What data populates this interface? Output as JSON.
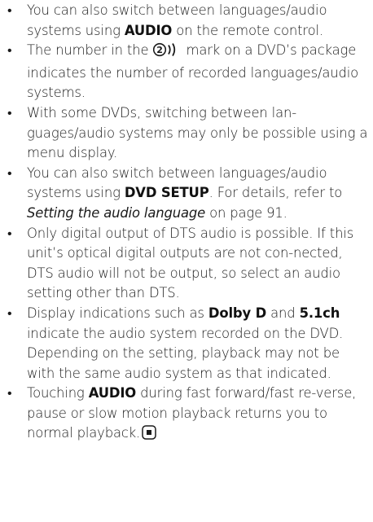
{
  "bullets": [
    {
      "pre": "You can also switch between languages/audio systems using ",
      "bold": "AUDIO",
      "post": " on the remote control."
    },
    {
      "pre": "The number in the ",
      "icon_name": "audio-languages-mark-icon",
      "icon_digit": "2",
      "post": " mark on a DVD’s package indicates the number of recorded languages/audio systems."
    },
    {
      "text": "With some DVDs, switching between lan-guages/audio systems may only be possible using a menu display."
    },
    {
      "pre": "You can also switch between languages/audio systems using ",
      "bold": "DVD SETUP",
      "mid": ". For details, refer to ",
      "italic": "Setting the audio language",
      "post": " on page 91."
    },
    {
      "text": "Only digital output of DTS audio is possible. If this unit’s optical digital outputs are not con-nected, DTS audio will not be output, so select an audio setting other than DTS."
    },
    {
      "pre": "Display indications such as ",
      "bold1": "Dolby D",
      "mid": " and ",
      "bold2": "5.1ch",
      "post": " indicate the audio system recorded on the DVD. Depending on the setting, playback may not be with the same audio system as that indicated."
    },
    {
      "pre": "Touching ",
      "bold": "AUDIO",
      "post": " during fast forward/fast re-verse, pause or slow motion playback returns you to normal playback.",
      "end_icon": "end-of-section-icon"
    }
  ]
}
